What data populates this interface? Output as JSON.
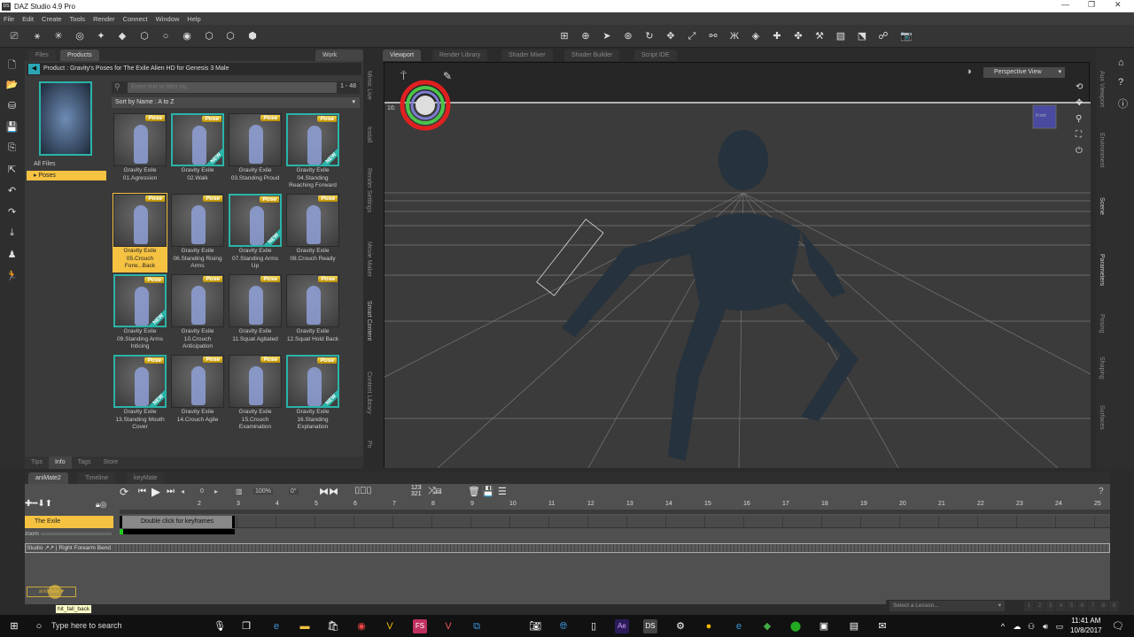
{
  "window": {
    "title": "DAZ Studio 4.9 Pro",
    "logo": "DS"
  },
  "menu": [
    "File",
    "Edit",
    "Create",
    "Tools",
    "Render",
    "Connect",
    "Window",
    "Help"
  ],
  "content": {
    "tabs": [
      "Files",
      "Products"
    ],
    "work_offline": "Work Offline",
    "product_label": "Product : Gravity's Poses for The Exile Alien HD for Genesis 3 Male",
    "tree": [
      "All Files",
      "Poses"
    ],
    "filter_placeholder": "Enter text to filter by...",
    "count": "1 - 48",
    "sort": "Sort by Name : A to Z",
    "items": [
      {
        "label": "Gravity Exile 01.Agression",
        "badge": "Pose",
        "new": false,
        "selected": false
      },
      {
        "label": "Gravity Exile 02.Walk",
        "badge": "Pose",
        "new": true,
        "selected": false
      },
      {
        "label": "Gravity Exile 03.Standing Proud",
        "badge": "Pose",
        "new": false,
        "selected": false
      },
      {
        "label": "Gravity Exile 04.Standing Reaching Forward",
        "badge": "Pose",
        "new": true,
        "selected": false
      },
      {
        "label": "Gravity Exile 05.Crouch Forw...Back",
        "badge": "Pose",
        "new": false,
        "selected": true
      },
      {
        "label": "Gravity Exile 06.Standing Rising Arms",
        "badge": "Pose",
        "new": false,
        "selected": false
      },
      {
        "label": "Gravity Exile 07.Standing Arms Up",
        "badge": "Pose",
        "new": true,
        "selected": false
      },
      {
        "label": "Gravity Exile 08.Crouch Ready",
        "badge": "Pose",
        "new": false,
        "selected": false
      },
      {
        "label": "Gravity Exile 09.Standing Arms Inticing",
        "badge": "Pose",
        "new": true,
        "selected": false
      },
      {
        "label": "Gravity Exile 10.Crouch Anticipation",
        "badge": "Pose",
        "new": false,
        "selected": false
      },
      {
        "label": "Gravity Exile 11.Squat Agitated",
        "badge": "Pose",
        "new": false,
        "selected": false
      },
      {
        "label": "Gravity Exile 12.Squat Hold Back",
        "badge": "Pose",
        "new": false,
        "selected": false
      },
      {
        "label": "Gravity Exile 13.Standing Mouth Cover",
        "badge": "Pose",
        "new": true,
        "selected": false
      },
      {
        "label": "Gravity Exile 14.Crouch Agile",
        "badge": "Pose",
        "new": false,
        "selected": false
      },
      {
        "label": "Gravity Exile 15.Crouch Examination",
        "badge": "Pose",
        "new": false,
        "selected": false
      },
      {
        "label": "Gravity Exile 16.Standing Explanation",
        "badge": "Pose",
        "new": true,
        "selected": false
      }
    ],
    "new_tag": "NEW",
    "side_tabs": [
      "Mimic Live",
      "Install",
      "Render Settings",
      "Movie Maker",
      "Smart Content",
      "Content Library",
      "Po"
    ],
    "bottom_tabs": [
      "Tips",
      "Info",
      "Tags",
      "Store"
    ]
  },
  "viewport": {
    "tabs": [
      "Viewport",
      "Render Library",
      "Shader Mixer",
      "Shader Builder",
      "Script IDE"
    ],
    "view_select": "Perspective View",
    "frame_label": "16:",
    "cube_label": "Front"
  },
  "right_tabs": [
    "Aux Viewport",
    "Environment",
    "Scene",
    "Parameters",
    "Posing",
    "Shaping",
    "Surfaces"
  ],
  "animate": {
    "tabs": [
      "aniMate2",
      "Timeline",
      "keyMate"
    ],
    "frame": "0",
    "zoom_pct": "100%",
    "angle": "0°",
    "ruler": [
      "2",
      "3",
      "4",
      "5",
      "6",
      "7",
      "8",
      "9",
      "10",
      "11",
      "12",
      "13",
      "14",
      "15",
      "16",
      "17",
      "18",
      "19",
      "20",
      "21",
      "22",
      "23",
      "24",
      "25"
    ],
    "track_name": "The Exile",
    "block_label": "Double click for keyframes",
    "zoom_label": "zoom",
    "row2": "Studio ↗↗ | Right Forearm Bend",
    "dropdown": "aniMate ▾",
    "tooltip": "hit_fall_back"
  },
  "lesson": {
    "select": "Select a Lesson...",
    "pages": [
      "1",
      "2",
      "3",
      "4",
      "5",
      "6",
      "7",
      "8",
      "9"
    ]
  },
  "taskbar": {
    "search": "Type here to search",
    "time": "11:41 AM",
    "date": "10/8/2017"
  }
}
